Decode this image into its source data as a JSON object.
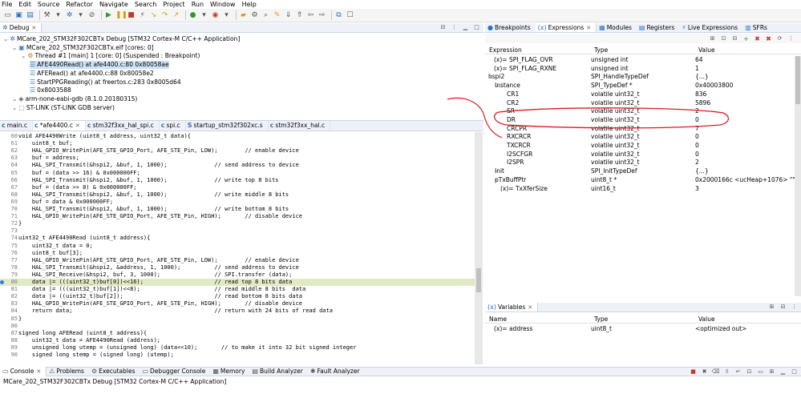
{
  "menu": [
    "File",
    "Edit",
    "Source",
    "Refactor",
    "Navigate",
    "Search",
    "Project",
    "Run",
    "Window",
    "Help"
  ],
  "debug": {
    "tab": "Debug",
    "tree": [
      {
        "indent": 0,
        "icon": "debug-config-icon",
        "text": "MCare_202_STM32F302CBTx Debug [STM32 Cortex-M C/C++ Application]",
        "selected": false
      },
      {
        "indent": 1,
        "icon": "elf-icon",
        "text": "MCare_202_STM32F302CBTx.elf [cores: 0]",
        "selected": false
      },
      {
        "indent": 2,
        "icon": "thread-icon",
        "text": "Thread #1 [main] 1 [core: 0] (Suspended : Breakpoint)",
        "selected": false
      },
      {
        "indent": 3,
        "icon": "stack-frame-icon",
        "text": "AFE4490Read() at afe4400.c:80 0x80058ae",
        "selected": true
      },
      {
        "indent": 3,
        "icon": "stack-frame-icon",
        "text": "AFERead() at afe4400.c:88 0x80058e2",
        "selected": false
      },
      {
        "indent": 3,
        "icon": "stack-frame-icon",
        "text": "StartPPGReading() at freertos.c:283 0x8005d64",
        "selected": false
      },
      {
        "indent": 3,
        "icon": "stack-frame-icon",
        "text": "0x8003588",
        "selected": false
      },
      {
        "indent": 1,
        "icon": "gdb-icon",
        "text": "arm-none-eabi-gdb (8.1.0.20180315)",
        "selected": false
      },
      {
        "indent": 1,
        "icon": "stlink-icon",
        "text": "ST-LINK (ST-LINK GDB server)",
        "selected": false
      }
    ]
  },
  "editor": {
    "tabs": [
      "main.c",
      "*afe4400.c",
      "stm32f3xx_hal_spi.c",
      "spi.c",
      "startup_stm32f302xc.s",
      "stm32f3xx_hal.c"
    ],
    "active_tab": 1,
    "lines": [
      {
        "n": "60",
        "t": "void AFE4490Write (uint8_t address, uint32_t data){"
      },
      {
        "n": "61",
        "t": "    uint8_t buf;"
      },
      {
        "n": "62",
        "t": "    HAL_GPIO_WritePin(AFE_STE_GPIO_Port, AFE_STE_Pin, LOW);        // enable device"
      },
      {
        "n": "63",
        "t": "    buf = address;"
      },
      {
        "n": "64",
        "t": "    HAL_SPI_Transmit(&hspi2, &buf, 1, 1000);              // send address to device"
      },
      {
        "n": "65",
        "t": "    buf = (data >> 16) & 0x000000FF;"
      },
      {
        "n": "66",
        "t": "    HAL_SPI_Transmit(&hspi2, &buf, 1, 1000);              // write top 8 bits"
      },
      {
        "n": "67",
        "t": "    buf = (data >> 8) & 0x000000FF;"
      },
      {
        "n": "68",
        "t": "    HAL_SPI_Transmit(&hspi2, &buf, 1, 1000);              // write middle 8 bits"
      },
      {
        "n": "69",
        "t": "    buf = data & 0x000000FF;"
      },
      {
        "n": "70",
        "t": "    HAL_SPI_Transmit(&hspi2, &buf, 1, 1000);              // write bottom 8 bits"
      },
      {
        "n": "71",
        "t": "    HAL_GPIO_WritePin(AFE_STE_GPIO_Port, AFE_STE_Pin, HIGH);       // disable device"
      },
      {
        "n": "72",
        "t": "}"
      },
      {
        "n": "73",
        "t": ""
      },
      {
        "n": "74",
        "t": "uint32_t AFE4490Read (uint8_t address){"
      },
      {
        "n": "75",
        "t": "    uint32_t data = 0;"
      },
      {
        "n": "76",
        "t": "    uint8_t buf[3];"
      },
      {
        "n": "77",
        "t": "    HAL_GPIO_WritePin(AFE_STE_GPIO_Port, AFE_STE_Pin, LOW);        // enable device"
      },
      {
        "n": "78",
        "t": "    HAL_SPI_Transmit(&hspi2, &address, 1, 1000);          // send address to device"
      },
      {
        "n": "79",
        "t": "    HAL_SPI_Receive(&hspi2, buf, 3, 1000);                // SPI.transfer (data);"
      },
      {
        "n": "80",
        "t": "    data |= (((uint32_t)buf[0])<<16);                     // read top 8 bits data"
      },
      {
        "n": "81",
        "t": "    data |= (((uint32_t)buf[1])<<8);                      // read middle 8 bits  data"
      },
      {
        "n": "82",
        "t": "    data |= ((uint32_t)buf[2]);                           // read bottom 8 bits data"
      },
      {
        "n": "83",
        "t": "    HAL_GPIO_WritePin(AFE_STE_GPIO_Port, AFE_STE_Pin, HIGH);       // disable device"
      },
      {
        "n": "84",
        "t": "    return data;                                          // return with 24 bits of read data"
      },
      {
        "n": "85",
        "t": "}"
      },
      {
        "n": "86",
        "t": ""
      },
      {
        "n": "87",
        "t": "signed long AFERead (uint8_t address){"
      },
      {
        "n": "88",
        "t": "    uint32_t data = AFE4490Read (address);"
      },
      {
        "n": "89",
        "t": "    unsigned long utemp = (unsigned long) (data<<10);       // to make it into 32 bit signed integer"
      },
      {
        "n": "90",
        "t": "    signed long stemp = (signed long) (utemp);"
      }
    ],
    "current_line": "80"
  },
  "expressions": {
    "tabs": [
      "Breakpoints",
      "Expressions",
      "Modules",
      "Registers",
      "Live Expressions",
      "SFRs"
    ],
    "active_tab": 1,
    "headers": [
      "Expression",
      "Type",
      "Value"
    ],
    "rows": [
      {
        "indent": 0,
        "exp": "(x)= SPI_FLAG_OVR",
        "type": "unsigned int",
        "value": "64"
      },
      {
        "indent": 0,
        "exp": "(x)= SPI_FLAG_RXNE",
        "type": "unsigned int",
        "value": "1"
      },
      {
        "indent": 0,
        "exp": "hspi2",
        "type": "SPI_HandleTypeDef",
        "value": "{...}",
        "toggle": "v"
      },
      {
        "indent": 1,
        "exp": "Instance",
        "type": "SPI_TypeDef *",
        "value": "0x40003800",
        "toggle": "v"
      },
      {
        "indent": 2,
        "exp": "CR1",
        "type": "volatile uint32_t",
        "value": "836"
      },
      {
        "indent": 2,
        "exp": "CR2",
        "type": "volatile uint32_t",
        "value": "5896"
      },
      {
        "indent": 2,
        "exp": "SR",
        "type": "volatile uint32_t",
        "value": "2"
      },
      {
        "indent": 2,
        "exp": "DR",
        "type": "volatile uint32_t",
        "value": "0"
      },
      {
        "indent": 2,
        "exp": "CRCPR",
        "type": "volatile uint32_t",
        "value": "7"
      },
      {
        "indent": 2,
        "exp": "RXCRCR",
        "type": "volatile uint32_t",
        "value": "0"
      },
      {
        "indent": 2,
        "exp": "TXCRCR",
        "type": "volatile uint32_t",
        "value": "0"
      },
      {
        "indent": 2,
        "exp": "I2SCFGR",
        "type": "volatile uint32_t",
        "value": "0"
      },
      {
        "indent": 2,
        "exp": "I2SPR",
        "type": "volatile uint32_t",
        "value": "2"
      },
      {
        "indent": 1,
        "exp": "Init",
        "type": "SPI_InitTypeDef",
        "value": "{...}",
        "toggle": ">"
      },
      {
        "indent": 1,
        "exp": "pTxBuffPtr",
        "type": "uint8_t *",
        "value": "0x2000166c <ucHeap+1076> \"\"",
        "toggle": ">"
      },
      {
        "indent": 1,
        "exp": "(x)= TxXferSize",
        "type": "uint16_t",
        "value": "3"
      }
    ]
  },
  "variables": {
    "tab": "Variables",
    "headers": [
      "Name",
      "Type",
      "Value"
    ],
    "rows": [
      {
        "name": "(x)= address",
        "type": "uint8_t",
        "value": "<optimized out>"
      }
    ]
  },
  "console": {
    "tabs": [
      "Console",
      "Problems",
      "Executables",
      "Debugger Console",
      "Memory",
      "Build Analyzer",
      "Fault Analyzer"
    ],
    "active_tab": 0,
    "text": "MCare_202_STM32F302CBTx Debug [STM32 Cortex-M C/C++ Application]"
  },
  "annotation_color": "#e0191e",
  "colors": {
    "current_line": "#e0ebc5",
    "selection": "#cfe3f7",
    "tab_bar": "#eef2f8"
  }
}
